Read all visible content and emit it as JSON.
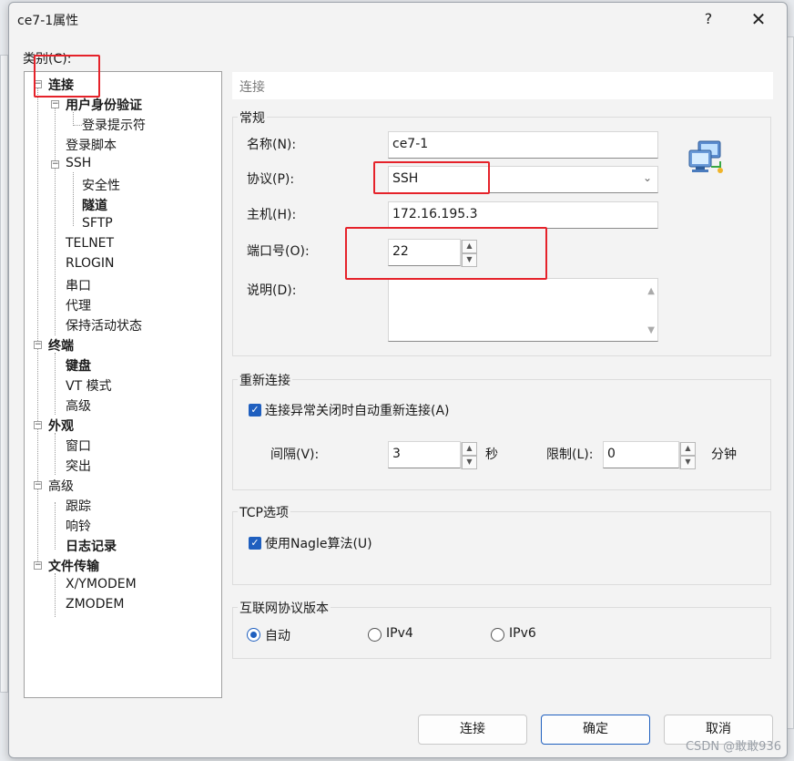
{
  "window": {
    "title": "ce7-1属性",
    "help": "?",
    "close": "✕"
  },
  "category_label": "类别(C):",
  "tree": [
    {
      "label": "连接",
      "bold": true
    },
    {
      "label": "用户身份验证",
      "bold": true
    },
    {
      "label": "登录提示符",
      "bold": false
    },
    {
      "label": "登录脚本",
      "bold": false
    },
    {
      "label": "SSH",
      "bold": false
    },
    {
      "label": "安全性",
      "bold": false
    },
    {
      "label": "隧道",
      "bold": true
    },
    {
      "label": "SFTP",
      "bold": false
    },
    {
      "label": "TELNET",
      "bold": false
    },
    {
      "label": "RLOGIN",
      "bold": false
    },
    {
      "label": "串口",
      "bold": false
    },
    {
      "label": "代理",
      "bold": false
    },
    {
      "label": "保持活动状态",
      "bold": false
    },
    {
      "label": "终端",
      "bold": true
    },
    {
      "label": "键盘",
      "bold": true
    },
    {
      "label": "VT 模式",
      "bold": false
    },
    {
      "label": "高级",
      "bold": false
    },
    {
      "label": "外观",
      "bold": true
    },
    {
      "label": "窗口",
      "bold": false
    },
    {
      "label": "突出",
      "bold": false
    },
    {
      "label": "高级",
      "bold": false
    },
    {
      "label": "跟踪",
      "bold": false
    },
    {
      "label": "响铃",
      "bold": false
    },
    {
      "label": "日志记录",
      "bold": true
    },
    {
      "label": "文件传输",
      "bold": true
    },
    {
      "label": "X/YMODEM",
      "bold": false
    },
    {
      "label": "ZMODEM",
      "bold": false
    }
  ],
  "panel_header": "连接",
  "general": {
    "group_label": "常规",
    "name_label": "名称(N):",
    "name_value": "ce7-1",
    "protocol_label": "协议(P):",
    "protocol_value": "SSH",
    "host_label": "主机(H):",
    "host_value": "172.16.195.3",
    "port_label": "端口号(O):",
    "port_value": "22",
    "desc_label": "说明(D):",
    "desc_value": ""
  },
  "reconnect": {
    "group_label": "重新连接",
    "checkbox_label": "连接异常关闭时自动重新连接(A)",
    "checked": true,
    "interval_label": "间隔(V):",
    "interval_value": "3",
    "interval_unit": "秒",
    "limit_label": "限制(L):",
    "limit_value": "0",
    "limit_unit": "分钟"
  },
  "tcp": {
    "group_label": "TCP选项",
    "nagle_label": "使用Nagle算法(U)",
    "nagle_checked": true
  },
  "ip_version": {
    "group_label": "互联网协议版本",
    "options": [
      "自动",
      "IPv4",
      "IPv6"
    ],
    "selected": "自动"
  },
  "buttons": {
    "connect": "连接",
    "ok": "确定",
    "cancel": "取消"
  },
  "watermark": "CSDN @敢敢936",
  "colors": {
    "highlight": "#e5222a",
    "accent": "#1f5fbf"
  }
}
